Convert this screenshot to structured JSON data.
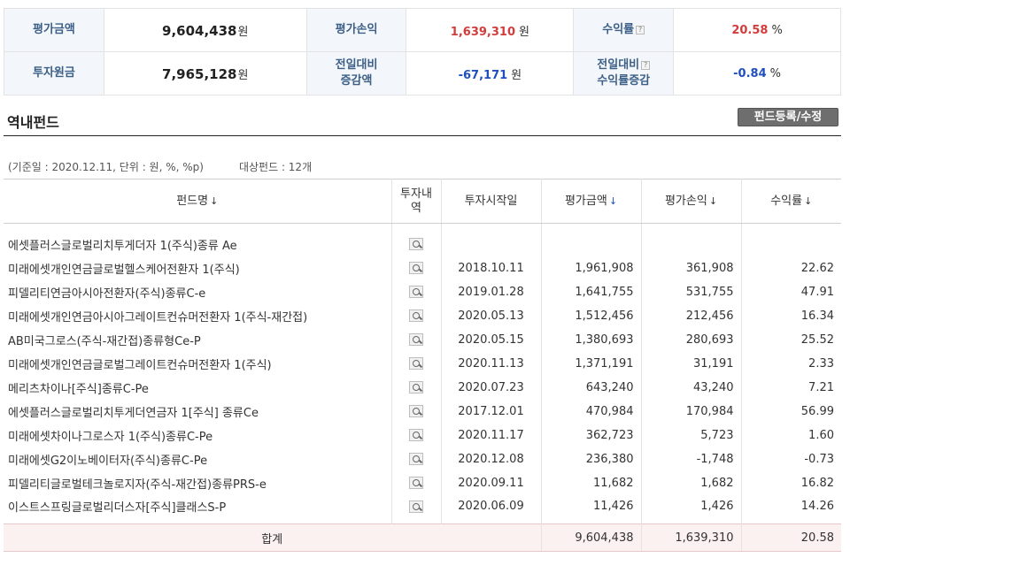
{
  "summary": {
    "eval_amount_label": "평가금액",
    "eval_amount_value": "9,604,438",
    "principal_label": "투자원금",
    "principal_value": "7,965,128",
    "won": "원",
    "pnl_label": "평가손익",
    "pnl_value": "1,639,310",
    "day_change_label_1": "전일대비",
    "day_change_label_2": "증감액",
    "day_change_value": "-67,171",
    "return_label": "수익률",
    "return_value": "20.58",
    "return_change_label_1": "전일대비",
    "return_change_label_2": "수익률증감",
    "return_change_value": "-0.84",
    "percent": "%",
    "help_mark": "?"
  },
  "section": {
    "title": "역내펀드",
    "register_button": "펀드등록/수정",
    "base_info": "(기준일 : 2020.12.11, 단위 : 원, %, %p)",
    "fund_count": "대상펀드 : 12개"
  },
  "table": {
    "headers": {
      "name": "펀드명",
      "detail_1": "투자내",
      "detail_2": "역",
      "start": "투자시작일",
      "eval": "평가금액",
      "pnl": "평가손익",
      "rate": "수익률",
      "sort_arrow": "↓"
    },
    "rows": [
      {
        "name": "에셋플러스글로벌리치투게더자 1(주식)종류 Ae",
        "start": "",
        "eval": "",
        "pnl": "",
        "rate": "",
        "sign": "pos"
      },
      {
        "name": "미래에셋개인연금글로벌헬스케어전환자 1(주식)",
        "start": "2018.10.11",
        "eval": "1,961,908",
        "pnl": "361,908",
        "rate": "22.62",
        "sign": "pos"
      },
      {
        "name": "피델리티연금아시아전환자(주식)종류C-e",
        "start": "2019.01.28",
        "eval": "1,641,755",
        "pnl": "531,755",
        "rate": "47.91",
        "sign": "pos"
      },
      {
        "name": "미래에셋개인연금아시아그레이트컨슈머전환자 1(주식-재간접)",
        "start": "2020.05.13",
        "eval": "1,512,456",
        "pnl": "212,456",
        "rate": "16.34",
        "sign": "pos"
      },
      {
        "name": "AB미국그로스(주식-재간접)종류형Ce-P",
        "start": "2020.05.15",
        "eval": "1,380,693",
        "pnl": "280,693",
        "rate": "25.52",
        "sign": "pos"
      },
      {
        "name": "미래에셋개인연금글로벌그레이트컨슈머전환자 1(주식)",
        "start": "2020.11.13",
        "eval": "1,371,191",
        "pnl": "31,191",
        "rate": "2.33",
        "sign": "pos"
      },
      {
        "name": "메리츠차이나[주식]종류C-Pe",
        "start": "2020.07.23",
        "eval": "643,240",
        "pnl": "43,240",
        "rate": "7.21",
        "sign": "pos"
      },
      {
        "name": "에셋플러스글로벌리치투게더연금자 1[주식] 종류Ce",
        "start": "2017.12.01",
        "eval": "470,984",
        "pnl": "170,984",
        "rate": "56.99",
        "sign": "pos"
      },
      {
        "name": "미래에셋차이나그로스자 1(주식)종류C-Pe",
        "start": "2020.11.17",
        "eval": "362,723",
        "pnl": "5,723",
        "rate": "1.60",
        "sign": "pos"
      },
      {
        "name": "미래에셋G2이노베이터자(주식)종류C-Pe",
        "start": "2020.12.08",
        "eval": "236,380",
        "pnl": "-1,748",
        "rate": "-0.73",
        "sign": "neg"
      },
      {
        "name": "피델리티글로벌테크놀로지자(주식-재간접)종류PRS-e",
        "start": "2020.09.11",
        "eval": "11,682",
        "pnl": "1,682",
        "rate": "16.82",
        "sign": "pos"
      },
      {
        "name": "이스트스프링글로벌리더스자[주식]클래스S-P",
        "start": "2020.06.09",
        "eval": "11,426",
        "pnl": "1,426",
        "rate": "14.26",
        "sign": "pos"
      }
    ],
    "total": {
      "label": "합계",
      "eval": "9,604,438",
      "pnl": "1,639,310",
      "rate": "20.58"
    }
  }
}
